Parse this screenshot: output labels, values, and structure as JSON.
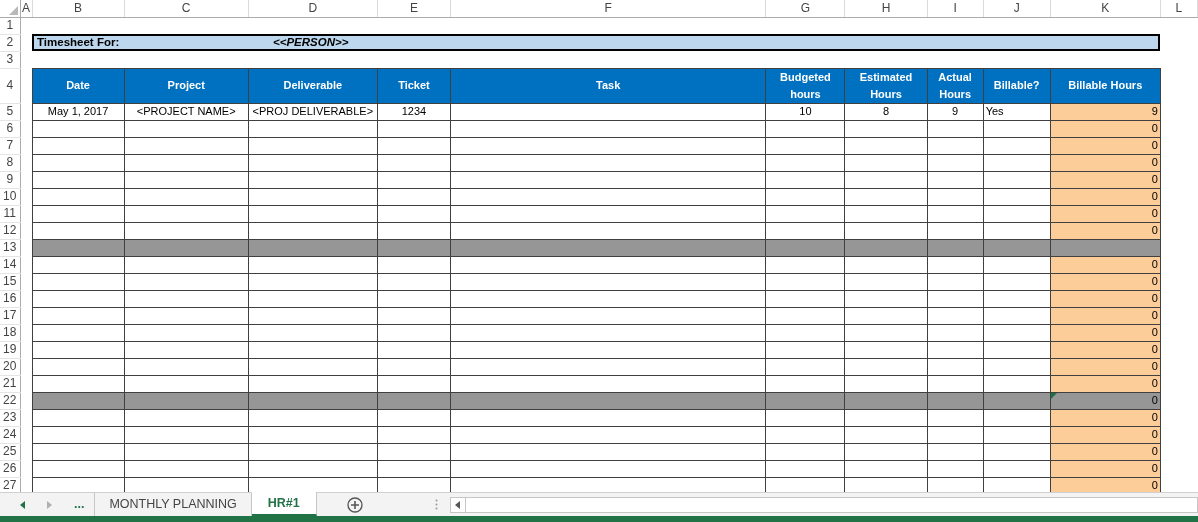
{
  "column_headers": [
    "A",
    "B",
    "C",
    "D",
    "E",
    "F",
    "G",
    "H",
    "I",
    "J",
    "K",
    "L"
  ],
  "row_numbers": [
    "1",
    "2",
    "3",
    "4",
    "5",
    "6",
    "7",
    "8",
    "9",
    "10",
    "11",
    "12",
    "13",
    "14",
    "15",
    "16",
    "17",
    "18",
    "19",
    "20",
    "21",
    "22",
    "23",
    "24",
    "25",
    "26",
    "27"
  ],
  "title_bar": {
    "label": "Timesheet For:",
    "person": "<<PERSON>>"
  },
  "table": {
    "columns": [
      "Date",
      "Project",
      "Deliverable",
      "Ticket",
      "Task",
      "Budgeted hours",
      "Estimated Hours",
      "Actual Hours",
      "Billable?",
      "Billable Hours"
    ],
    "rows": [
      {
        "kind": "entry",
        "cells": {
          "date": "May 1, 2017",
          "project": "<PROJECT NAME>",
          "deliverable": "<PROJ DELIVERABLE>",
          "ticket": "1234",
          "budgeted_hours": "10",
          "estimated_hours": "8",
          "actual_hours": "9",
          "billable": "Yes",
          "billable_hours": "9"
        }
      },
      {
        "kind": "entry",
        "cells": {
          "billable_hours": "0"
        }
      },
      {
        "kind": "entry",
        "cells": {
          "billable_hours": "0"
        }
      },
      {
        "kind": "entry",
        "cells": {
          "billable_hours": "0"
        }
      },
      {
        "kind": "entry",
        "cells": {
          "billable_hours": "0"
        }
      },
      {
        "kind": "entry",
        "cells": {
          "billable_hours": "0"
        }
      },
      {
        "kind": "entry",
        "cells": {
          "billable_hours": "0"
        }
      },
      {
        "kind": "entry",
        "cells": {
          "billable_hours": "0"
        }
      },
      {
        "kind": "separator",
        "cells": {}
      },
      {
        "kind": "entry",
        "cells": {
          "billable_hours": "0"
        }
      },
      {
        "kind": "entry",
        "cells": {
          "billable_hours": "0"
        }
      },
      {
        "kind": "entry",
        "cells": {
          "billable_hours": "0"
        }
      },
      {
        "kind": "entry",
        "cells": {
          "billable_hours": "0"
        }
      },
      {
        "kind": "entry",
        "cells": {
          "billable_hours": "0"
        }
      },
      {
        "kind": "entry",
        "cells": {
          "billable_hours": "0"
        }
      },
      {
        "kind": "entry",
        "cells": {
          "billable_hours": "0"
        }
      },
      {
        "kind": "entry",
        "cells": {
          "billable_hours": "0"
        }
      },
      {
        "kind": "separator",
        "error_indicator": true,
        "cells": {
          "billable_hours": "0"
        }
      },
      {
        "kind": "entry",
        "cells": {
          "billable_hours": "0"
        }
      },
      {
        "kind": "entry",
        "cells": {
          "billable_hours": "0"
        }
      },
      {
        "kind": "entry",
        "cells": {
          "billable_hours": "0"
        }
      },
      {
        "kind": "entry",
        "cells": {
          "billable_hours": "0"
        }
      },
      {
        "kind": "entry",
        "cells": {
          "billable_hours": "0"
        }
      }
    ]
  },
  "sheet_tabs": {
    "overflow": "...",
    "tabs": [
      {
        "label": "MONTHLY PLANNING",
        "selected": false
      },
      {
        "label": "HR#1",
        "selected": true
      }
    ]
  }
}
